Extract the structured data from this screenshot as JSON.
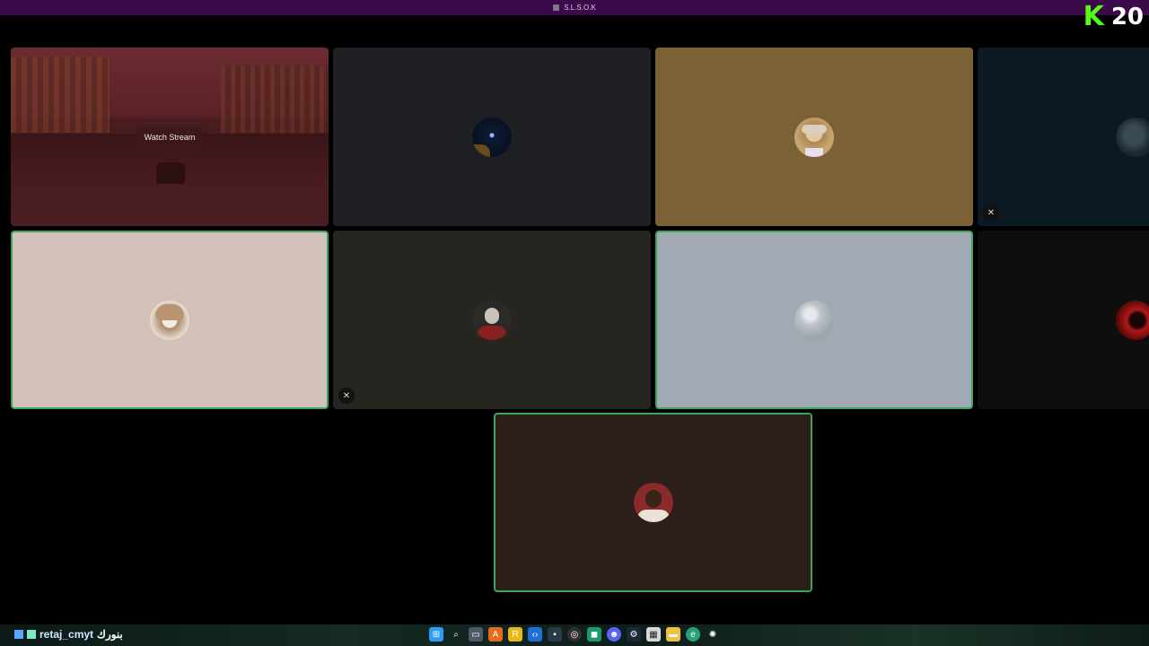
{
  "window": {
    "title": "S.L.S.O.K"
  },
  "overlay": {
    "count": "20",
    "brand_glyph": "K"
  },
  "colors": {
    "speaking_border": "#3ba55c",
    "kick_green": "#53fc18"
  },
  "tiles": [
    {
      "id": "stream",
      "button_label": "Watch Stream"
    },
    {
      "id": "user-2",
      "bg": "#1e1f22",
      "avatar": "dark-orb"
    },
    {
      "id": "user-3",
      "bg": "#7a6236",
      "avatar": "man-with-hat"
    },
    {
      "id": "user-4",
      "bg": "#0b1a22",
      "avatar": "dark-portrait",
      "muted": true
    },
    {
      "id": "user-5",
      "bg": "#d3c2b9",
      "avatar": "anime-character",
      "speaking": true
    },
    {
      "id": "user-6",
      "bg": "#26251f",
      "avatar": "bald-man-red-cape",
      "muted": true
    },
    {
      "id": "user-7",
      "bg": "#a1aab3",
      "avatar": "gray-sphere",
      "speaking": true
    },
    {
      "id": "user-8",
      "bg": "#0e0e0e",
      "avatar": "red-moon"
    },
    {
      "id": "user-9",
      "bg": "#2c1f1a",
      "avatar": "man-portrait",
      "speaking": true
    }
  ],
  "taskbar": {
    "user_label": "retaj_cmyt",
    "arabic_label": "بنورك",
    "icons": [
      "windows-start-icon",
      "search-icon",
      "task-view-icon",
      "app-orange-icon",
      "app-yellow-icon",
      "vscode-icon",
      "app-terminal-icon",
      "obs-icon",
      "app-green-icon",
      "discord-icon",
      "steam-icon",
      "calendar-icon",
      "file-explorer-icon",
      "edge-icon",
      "settings-icon"
    ]
  }
}
